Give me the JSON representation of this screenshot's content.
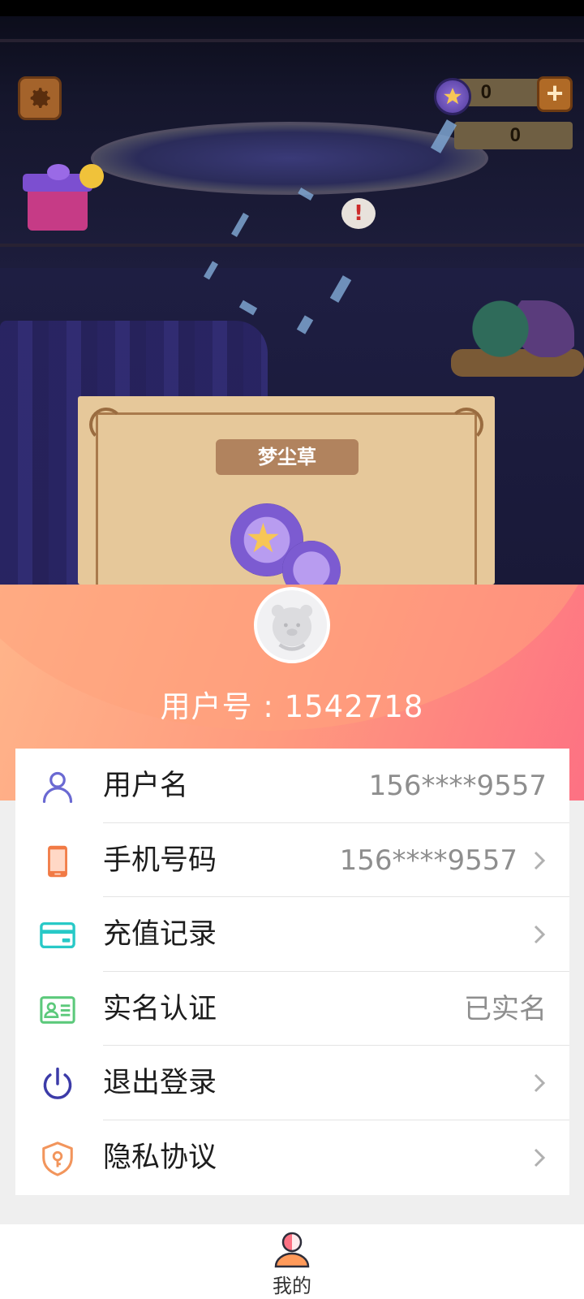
{
  "game": {
    "counter_top": "0",
    "counter_bottom": "0",
    "plus_label": "+",
    "alert_mark": "!",
    "card_title": "梦尘草"
  },
  "profile": {
    "user_id_text": "用户号 : 1542718"
  },
  "menu": {
    "items": [
      {
        "icon": "user-icon",
        "label": "用户名",
        "value": "156****9557",
        "has_arrow": false
      },
      {
        "icon": "phone-icon",
        "label": "手机号码",
        "value": "156****9557",
        "has_arrow": true
      },
      {
        "icon": "credit-card-icon",
        "label": "充值记录",
        "value": "",
        "has_arrow": true
      },
      {
        "icon": "id-card-icon",
        "label": "实名认证",
        "value": "已实名",
        "has_arrow": false
      },
      {
        "icon": "power-icon",
        "label": "退出登录",
        "value": "",
        "has_arrow": true
      },
      {
        "icon": "shield-lock-icon",
        "label": "隐私协议",
        "value": "",
        "has_arrow": true
      }
    ]
  },
  "bottom_nav": {
    "tabs": [
      {
        "icon": "profile-icon",
        "label": "我的"
      }
    ]
  },
  "colors": {
    "header_gradient_start": "#ffb58a",
    "header_gradient_end": "#fd7183",
    "user_icon": "#6a69d2",
    "phone_icon": "#f17a45",
    "card_icon": "#28c9c7",
    "id_icon": "#5cc97b",
    "power_icon": "#3c3ba8",
    "shield_icon": "#f2955c"
  }
}
